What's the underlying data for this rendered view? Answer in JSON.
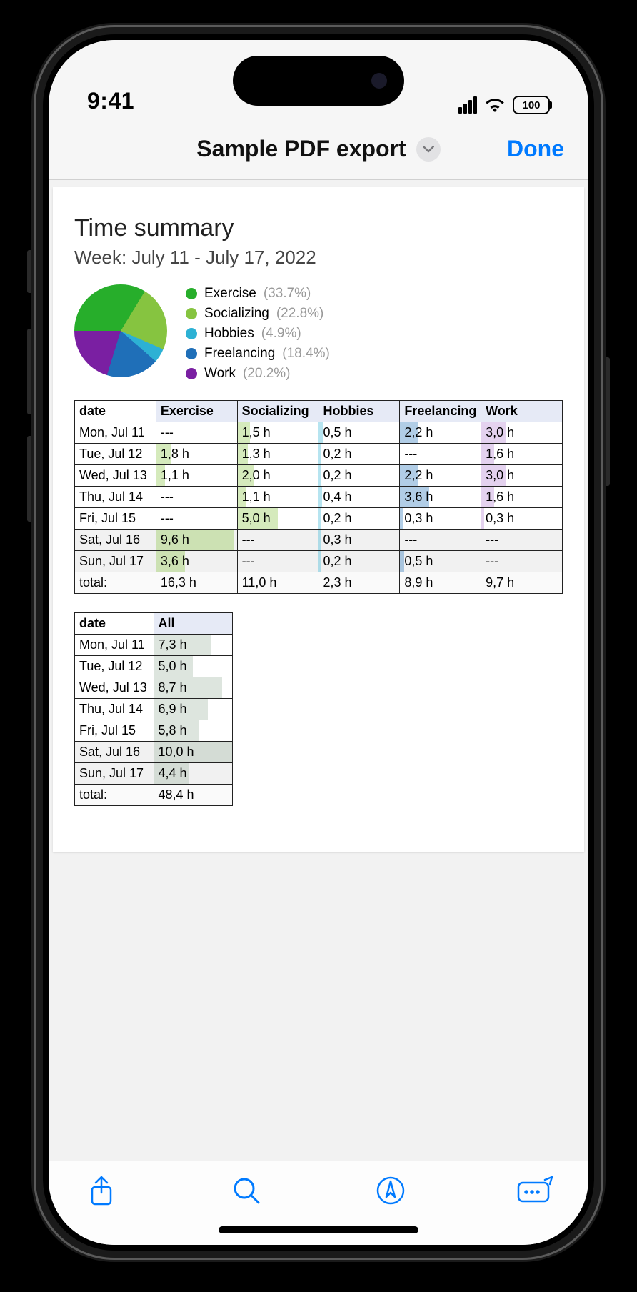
{
  "status": {
    "time": "9:41",
    "battery": "100"
  },
  "nav": {
    "title": "Sample PDF export",
    "done": "Done"
  },
  "doc": {
    "title": "Time summary",
    "subtitle": "Week: July 11 - July 17, 2022"
  },
  "chart_data": {
    "type": "pie",
    "title": "Time summary",
    "series": [
      {
        "name": "Exercise",
        "value": 33.7,
        "color": "#27ae2b"
      },
      {
        "name": "Socializing",
        "value": 22.8,
        "color": "#86c440"
      },
      {
        "name": "Hobbies",
        "value": 4.9,
        "color": "#2db1d4"
      },
      {
        "name": "Freelancing",
        "value": 18.4,
        "color": "#1f6fb8"
      },
      {
        "name": "Work",
        "value": 20.2,
        "color": "#7a1fa2"
      }
    ],
    "tables": {
      "detail": {
        "columns": [
          "date",
          "Exercise",
          "Socializing",
          "Hobbies",
          "Freelancing",
          "Work"
        ],
        "palette": {
          "Exercise": "#86c440",
          "Socializing": "#86c440",
          "Hobbies": "#2db1d4",
          "Freelancing": "#1f6fb8",
          "Work": "#b37fd1"
        },
        "rows": [
          {
            "date": "Mon, Jul 11",
            "weekend": false,
            "cells": {
              "Exercise": "---",
              "Socializing": "1,5 h",
              "Hobbies": "0,5 h",
              "Freelancing": "2,2 h",
              "Work": "3,0 h"
            }
          },
          {
            "date": "Tue, Jul 12",
            "weekend": false,
            "cells": {
              "Exercise": "1,8 h",
              "Socializing": "1,3 h",
              "Hobbies": "0,2 h",
              "Freelancing": "---",
              "Work": "1,6 h"
            }
          },
          {
            "date": "Wed, Jul 13",
            "weekend": false,
            "cells": {
              "Exercise": "1,1 h",
              "Socializing": "2,0 h",
              "Hobbies": "0,2 h",
              "Freelancing": "2,2 h",
              "Work": "3,0 h"
            }
          },
          {
            "date": "Thu, Jul 14",
            "weekend": false,
            "cells": {
              "Exercise": "---",
              "Socializing": "1,1 h",
              "Hobbies": "0,4 h",
              "Freelancing": "3,6 h",
              "Work": "1,6 h"
            }
          },
          {
            "date": "Fri, Jul 15",
            "weekend": false,
            "cells": {
              "Exercise": "---",
              "Socializing": "5,0 h",
              "Hobbies": "0,2 h",
              "Freelancing": "0,3 h",
              "Work": "0,3 h"
            }
          },
          {
            "date": "Sat, Jul 16",
            "weekend": true,
            "cells": {
              "Exercise": "9,6 h",
              "Socializing": "---",
              "Hobbies": "0,3 h",
              "Freelancing": "---",
              "Work": "---"
            }
          },
          {
            "date": "Sun, Jul 17",
            "weekend": true,
            "cells": {
              "Exercise": "3,6 h",
              "Socializing": "---",
              "Hobbies": "0,2 h",
              "Freelancing": "0,5 h",
              "Work": "---"
            }
          }
        ],
        "totals": {
          "label": "total:",
          "Exercise": "16,3 h",
          "Socializing": "11,0 h",
          "Hobbies": "2,3 h",
          "Freelancing": "8,9 h",
          "Work": "9,7 h"
        },
        "max": 10.0
      },
      "summary": {
        "columns": [
          "date",
          "All"
        ],
        "rows": [
          {
            "date": "Mon, Jul 11",
            "weekend": false,
            "All": "7,3 h"
          },
          {
            "date": "Tue, Jul 12",
            "weekend": false,
            "All": "5,0 h"
          },
          {
            "date": "Wed, Jul 13",
            "weekend": false,
            "All": "8,7 h"
          },
          {
            "date": "Thu, Jul 14",
            "weekend": false,
            "All": "6,9 h"
          },
          {
            "date": "Fri, Jul 15",
            "weekend": false,
            "All": "5,8 h"
          },
          {
            "date": "Sat, Jul 16",
            "weekend": true,
            "All": "10,0 h"
          },
          {
            "date": "Sun, Jul 17",
            "weekend": true,
            "All": "4,4 h"
          }
        ],
        "totals": {
          "label": "total:",
          "All": "48,4 h"
        },
        "max": 10.0
      }
    }
  }
}
